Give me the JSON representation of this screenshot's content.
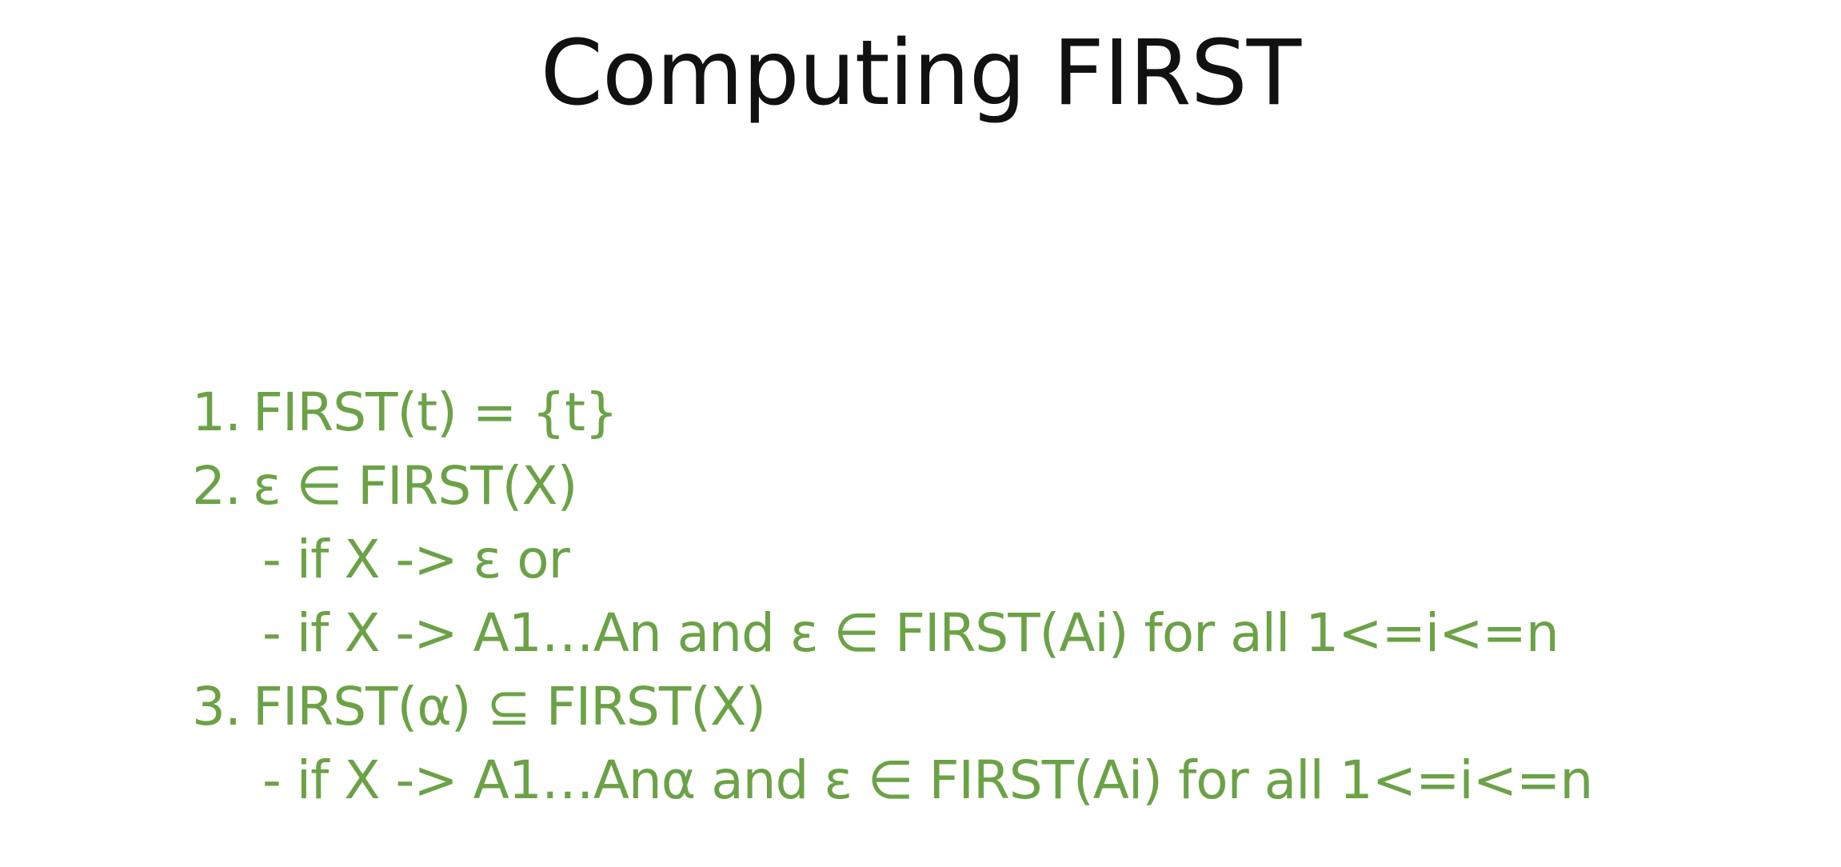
{
  "slide": {
    "title": "Computing FIRST",
    "lines": [
      {
        "num": "1.",
        "text": "FIRST(t) = {t}"
      },
      {
        "num": "2.",
        "text": "ε ∈ FIRST(X)"
      },
      {
        "text": "- if X -> ε or"
      },
      {
        "text": "- if X -> A1…An and ε ∈ FIRST(Ai) for all 1<=i<=n"
      },
      {
        "num": "3.",
        "text": "FIRST(α) ⊆ FIRST(X)"
      },
      {
        "text": "- if X -> A1…Anα and ε ∈ FIRST(Ai) for all 1<=i<=n"
      }
    ]
  },
  "colors": {
    "title": "#111111",
    "body": "#6ba246",
    "background": "#ffffff"
  }
}
